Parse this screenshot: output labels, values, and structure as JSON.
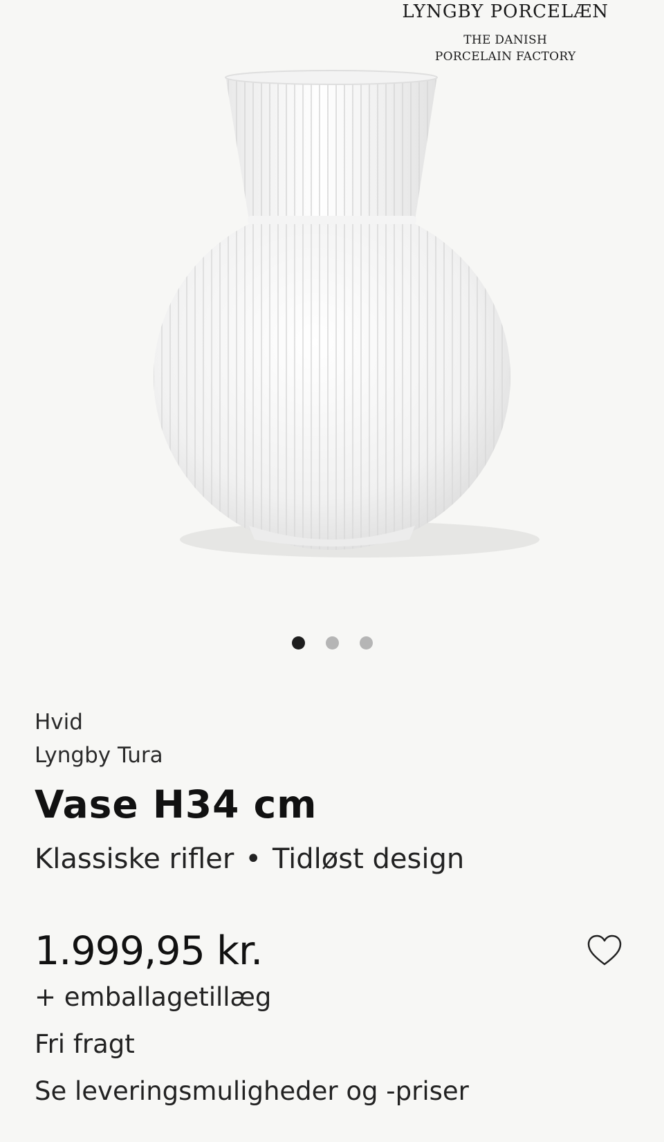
{
  "brand": {
    "name": "LYNGBY PORCELÆN",
    "subtitle_line1": "THE DANISH",
    "subtitle_line2": "PORCELAIN FACTORY"
  },
  "gallery": {
    "image_count": 3,
    "active_index": 0
  },
  "product": {
    "color": "Hvid",
    "series": "Lyngby Tura",
    "title": "Vase H34 cm",
    "feature_1": "Klassiske rifler",
    "feature_separator": "•",
    "feature_2": "Tidløst design",
    "price": "1.999,95 kr.",
    "packaging_note": "+ emballagetillæg",
    "shipping": "Fri fragt",
    "delivery_link": "Se leveringsmuligheder og -priser"
  },
  "icons": {
    "favorite": "heart-outline-icon"
  }
}
